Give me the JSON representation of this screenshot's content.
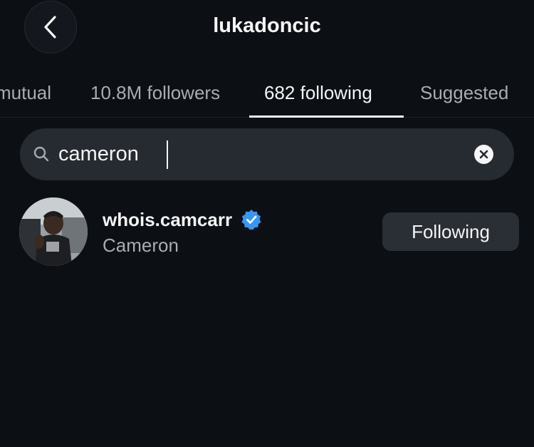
{
  "header": {
    "title": "lukadoncic"
  },
  "tabs": [
    {
      "label": "mutual",
      "active": false
    },
    {
      "label": "10.8M followers",
      "active": false
    },
    {
      "label": "682 following",
      "active": true
    },
    {
      "label": "Suggested",
      "active": false
    }
  ],
  "search": {
    "value": "cameron"
  },
  "results": [
    {
      "username": "whois.camcarr",
      "verified": true,
      "full_name": "Cameron",
      "button_label": "Following"
    }
  ],
  "colors": {
    "background": "#0c0f14",
    "search_bg": "#262a31",
    "button_bg": "#2a2e35",
    "verified_blue": "#3897f0"
  },
  "icons": [
    "back-chevron-icon",
    "search-icon",
    "clear-icon",
    "verified-badge-icon"
  ]
}
